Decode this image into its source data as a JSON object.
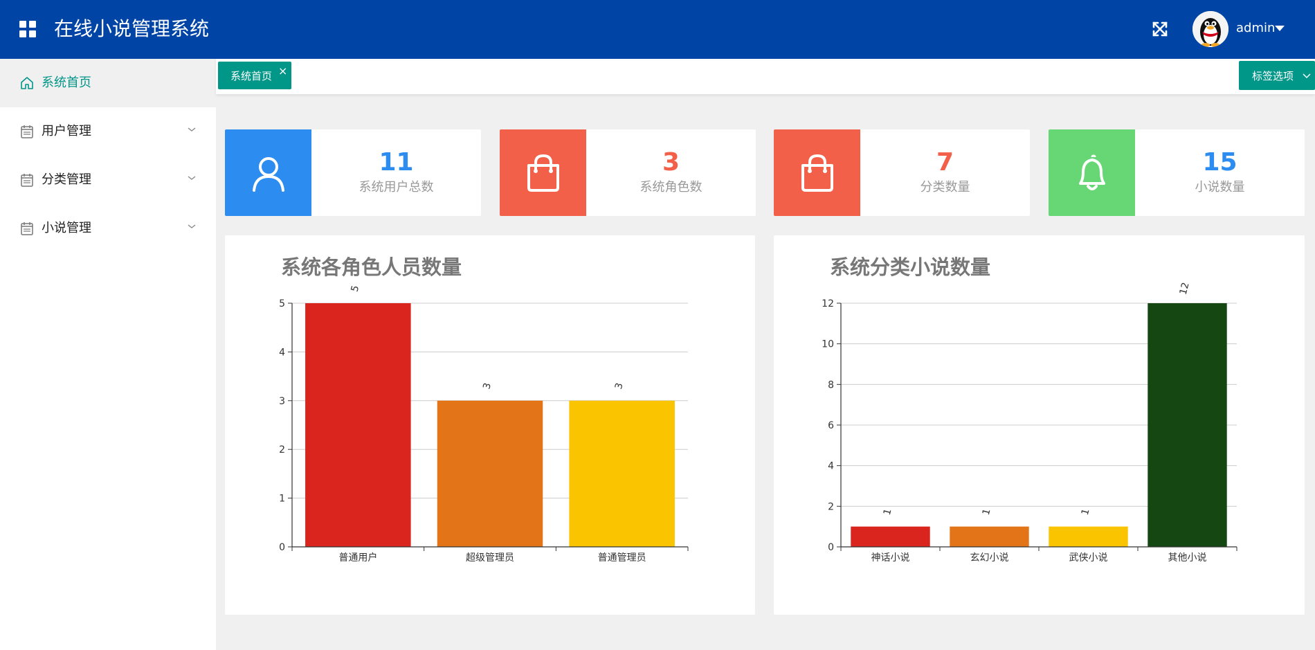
{
  "header": {
    "title": "在线小说管理系统",
    "user": "admin"
  },
  "sidebar": {
    "items": [
      {
        "label": "系统首页",
        "icon": "home-icon",
        "active": true
      },
      {
        "label": "用户管理",
        "icon": "calendar-icon"
      },
      {
        "label": "分类管理",
        "icon": "calendar-icon"
      },
      {
        "label": "小说管理",
        "icon": "calendar-icon"
      }
    ]
  },
  "tabs": {
    "items": [
      {
        "label": "系统首页",
        "close": "×"
      }
    ],
    "options_label": "标签选项"
  },
  "stats": [
    {
      "value": "11",
      "label": "系统用户总数",
      "icon": "user-icon",
      "box_color": "#2d8cf0",
      "value_color": "#2d8cf0"
    },
    {
      "value": "3",
      "label": "系统角色数",
      "icon": "shopping-bag-icon",
      "box_color": "#f26049",
      "value_color": "#f26049"
    },
    {
      "value": "7",
      "label": "分类数量",
      "icon": "shopping-bag-icon",
      "box_color": "#f26049",
      "value_color": "#f26049"
    },
    {
      "value": "15",
      "label": "小说数量",
      "icon": "bell-icon",
      "box_color": "#66d774",
      "value_color": "#2d8cf0"
    }
  ],
  "chart_data": [
    {
      "type": "bar",
      "title": "系统各角色人员数量",
      "categories": [
        "普通用户",
        "超级管理员",
        "普通管理员"
      ],
      "values": [
        5,
        3,
        3
      ],
      "colors": [
        "#d9251d",
        "#e47418",
        "#fbc400"
      ],
      "ylim": [
        0,
        5
      ],
      "yticks": [
        0,
        1,
        2,
        3,
        4,
        5
      ],
      "grid": true,
      "data_labels": true
    },
    {
      "type": "bar",
      "title": "系统分类小说数量",
      "categories": [
        "神话小说",
        "玄幻小说",
        "武侠小说",
        "其他小说"
      ],
      "values": [
        1,
        1,
        1,
        12
      ],
      "colors": [
        "#d9251d",
        "#e47418",
        "#fbc400",
        "#154713"
      ],
      "ylim": [
        0,
        12
      ],
      "yticks": [
        0,
        2,
        4,
        6,
        8,
        10,
        12
      ],
      "grid": true,
      "data_labels": true
    }
  ]
}
